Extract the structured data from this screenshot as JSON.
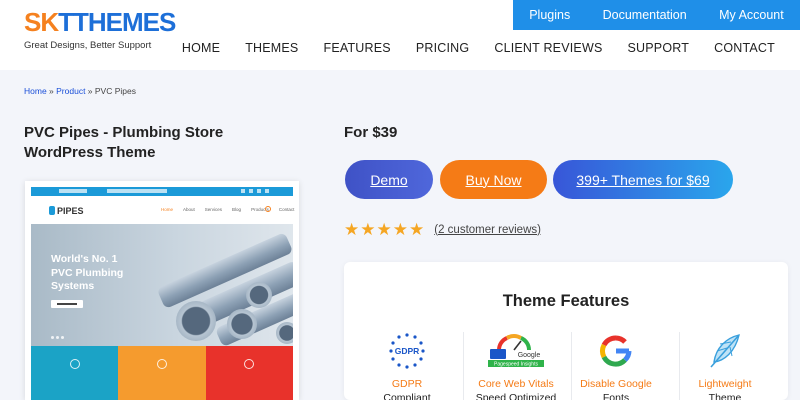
{
  "brand": {
    "logo_sk": "SK",
    "logo_t": "T",
    "logo_themes": "THEMES",
    "tagline": "Great Designs, Better Support"
  },
  "topbar": {
    "items": [
      "Plugins",
      "Documentation",
      "My Account"
    ],
    "color": "#1f8fe8"
  },
  "mainnav": {
    "items": [
      "HOME",
      "THEMES",
      "FEATURES",
      "PRICING",
      "CLIENT REVIEWS",
      "SUPPORT",
      "CONTACT"
    ]
  },
  "breadcrumb": {
    "home": "Home",
    "sep1": " » ",
    "product": "Product",
    "sep2": " » ",
    "current": "PVC Pipes"
  },
  "product": {
    "title": "PVC Pipes - Plumbing Store WordPress Theme",
    "price": "For $39"
  },
  "preview": {
    "logo": "PIPES",
    "menu": [
      "Home",
      "About",
      "Services",
      "Blog",
      "Products",
      "Contact"
    ],
    "hero_line1": "World's No. 1",
    "hero_line2": "PVC Plumbing",
    "hero_line3": "Systems",
    "tile_colors": [
      "#1ba3c6",
      "#f59b2e",
      "#e8322b"
    ]
  },
  "buttons": {
    "demo": "Demo",
    "buy": "Buy Now",
    "bundle": "399+ Themes for $69",
    "buy_color": "#f57b16"
  },
  "rating": {
    "stars": 5,
    "max": 5,
    "reviews": "(2 customer reviews)"
  },
  "features": {
    "title": "Theme Features",
    "items": [
      {
        "icon": "gdpr-icon",
        "label": "GDPR",
        "sub": "Compliant"
      },
      {
        "icon": "pagespeed-icon",
        "label": "Core Web Vitals",
        "sub": "Speed Optimized"
      },
      {
        "icon": "google-icon",
        "label": "Disable Google",
        "sub": "Fonts"
      },
      {
        "icon": "feather-icon",
        "label": "Lightweight",
        "sub": "Theme"
      }
    ]
  }
}
